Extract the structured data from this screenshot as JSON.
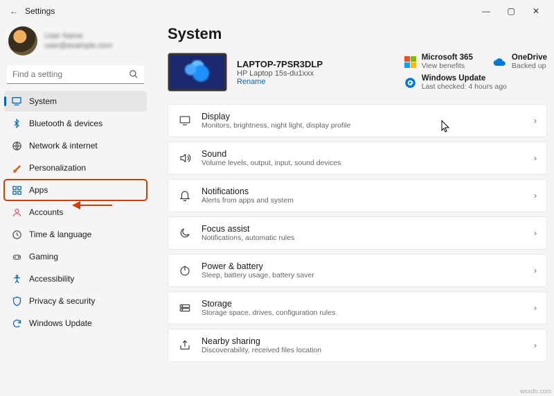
{
  "titlebar": {
    "title": "Settings"
  },
  "user": {
    "name": "User Name",
    "email": "user@example.com"
  },
  "search": {
    "placeholder": "Find a setting"
  },
  "nav": [
    {
      "id": "system",
      "label": "System",
      "selected": true
    },
    {
      "id": "bluetooth",
      "label": "Bluetooth & devices"
    },
    {
      "id": "network",
      "label": "Network & internet"
    },
    {
      "id": "personalization",
      "label": "Personalization"
    },
    {
      "id": "apps",
      "label": "Apps",
      "highlight": true
    },
    {
      "id": "accounts",
      "label": "Accounts"
    },
    {
      "id": "time",
      "label": "Time & language"
    },
    {
      "id": "gaming",
      "label": "Gaming"
    },
    {
      "id": "accessibility",
      "label": "Accessibility"
    },
    {
      "id": "privacy",
      "label": "Privacy & security"
    },
    {
      "id": "update",
      "label": "Windows Update"
    }
  ],
  "header": "System",
  "device": {
    "name": "LAPTOP-7PSR3DLP",
    "model": "HP Laptop 15s-du1xxx",
    "rename": "Rename"
  },
  "tiles": {
    "m365": {
      "title": "Microsoft 365",
      "sub": "View benefits"
    },
    "onedrive": {
      "title": "OneDrive",
      "sub": "Backed up"
    },
    "update": {
      "title": "Windows Update",
      "sub": "Last checked: 4 hours ago"
    }
  },
  "cards": [
    {
      "id": "display",
      "title": "Display",
      "sub": "Monitors, brightness, night light, display profile"
    },
    {
      "id": "sound",
      "title": "Sound",
      "sub": "Volume levels, output, input, sound devices"
    },
    {
      "id": "notifications",
      "title": "Notifications",
      "sub": "Alerts from apps and system"
    },
    {
      "id": "focus",
      "title": "Focus assist",
      "sub": "Notifications, automatic rules"
    },
    {
      "id": "power",
      "title": "Power & battery",
      "sub": "Sleep, battery usage, battery saver"
    },
    {
      "id": "storage",
      "title": "Storage",
      "sub": "Storage space, drives, configuration rules"
    },
    {
      "id": "nearby",
      "title": "Nearby sharing",
      "sub": "Discoverability, received files location"
    }
  ],
  "watermark": "wsxdn.com"
}
